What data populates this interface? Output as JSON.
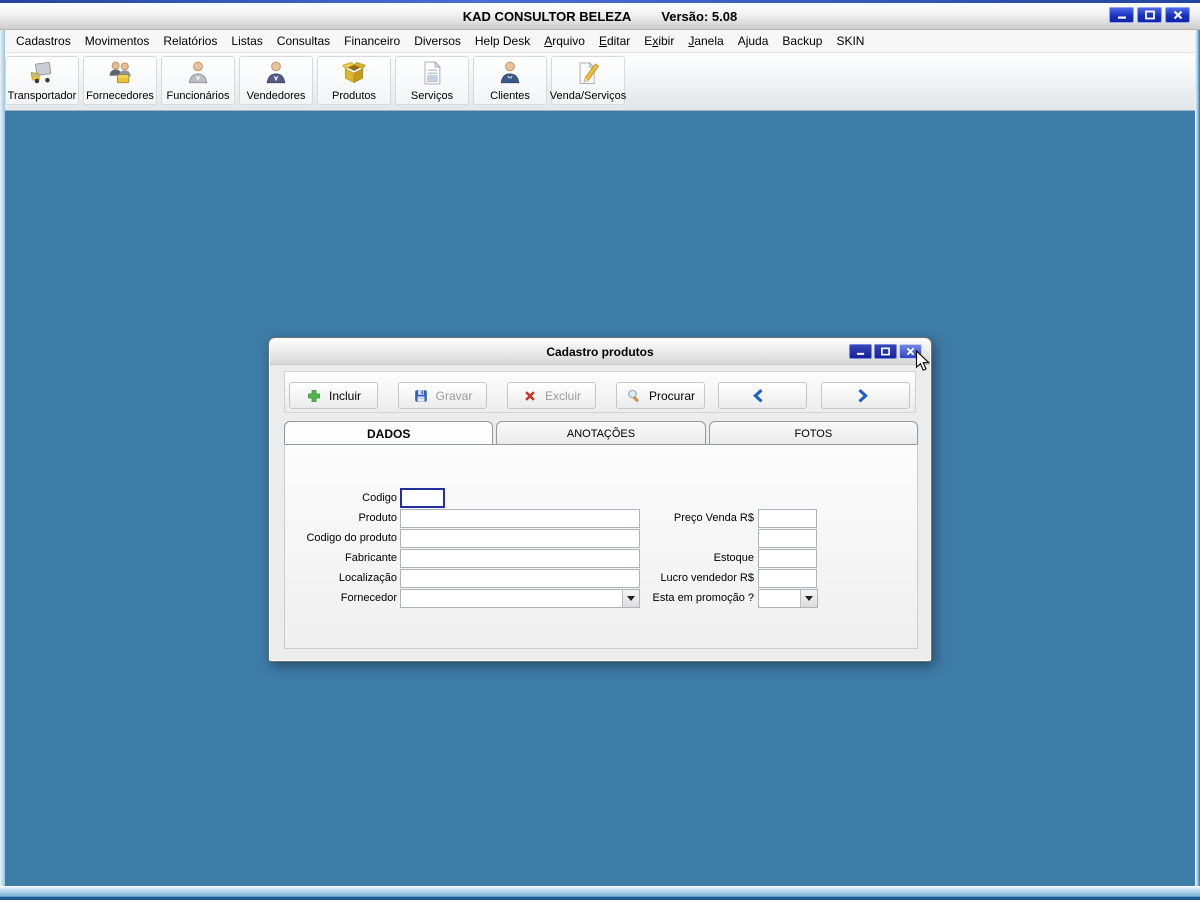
{
  "window": {
    "title": "KAD CONSULTOR BELEZA",
    "version": "Versão: 5.08"
  },
  "menubar": {
    "items": [
      {
        "label": "Cadastros"
      },
      {
        "label": "Movimentos"
      },
      {
        "label": "Relatórios"
      },
      {
        "label": "Listas"
      },
      {
        "label": "Consultas"
      },
      {
        "label": "Financeiro"
      },
      {
        "label": "Diversos"
      },
      {
        "label": "Help Desk"
      },
      {
        "label": "Arquivo",
        "accel": 0
      },
      {
        "label": "Editar",
        "accel": 0
      },
      {
        "label": "Exibir",
        "accel": 1
      },
      {
        "label": "Janela",
        "accel": 0
      },
      {
        "label": "Ajuda"
      },
      {
        "label": "Backup"
      },
      {
        "label": "SKIN"
      }
    ]
  },
  "toolbar": {
    "buttons": [
      {
        "label": "Transportador",
        "icon": "truck-icon"
      },
      {
        "label": "Fornecedores",
        "icon": "suppliers-icon"
      },
      {
        "label": "Funcionários",
        "icon": "employee-icon"
      },
      {
        "label": "Vendedores",
        "icon": "salesperson-icon"
      },
      {
        "label": "Produtos",
        "icon": "box-icon"
      },
      {
        "label": "Serviços",
        "icon": "document-icon"
      },
      {
        "label": "Clientes",
        "icon": "client-icon"
      },
      {
        "label": "Venda/Serviços",
        "icon": "sale-note-icon"
      }
    ]
  },
  "dialog": {
    "title": "Cadastro produtos",
    "toolbar": {
      "buttons": [
        {
          "label": "Incluir",
          "icon": "add-icon",
          "enabled": true
        },
        {
          "label": "Gravar",
          "icon": "save-icon",
          "enabled": false
        },
        {
          "label": "Excluir",
          "icon": "delete-icon",
          "enabled": false
        },
        {
          "label": "Procurar",
          "icon": "search-icon",
          "enabled": true
        },
        {
          "label": "",
          "icon": "chevron-left-icon",
          "enabled": true
        },
        {
          "label": "",
          "icon": "chevron-right-icon",
          "enabled": true
        }
      ]
    },
    "tabs": [
      {
        "label": "DADOS",
        "active": true
      },
      {
        "label": "ANOTAÇÕES",
        "active": false
      },
      {
        "label": "FOTOS",
        "active": false
      }
    ],
    "form": {
      "codigo": {
        "label": "Codigo",
        "value": ""
      },
      "produto": {
        "label": "Produto",
        "value": ""
      },
      "codigo_do_produto": {
        "label": "Codigo do produto",
        "value": ""
      },
      "fabricante": {
        "label": "Fabricante",
        "value": ""
      },
      "localizacao": {
        "label": "Localização",
        "value": ""
      },
      "fornecedor": {
        "label": "Fornecedor",
        "value": ""
      },
      "preco_venda": {
        "label": "Preço Venda R$",
        "value": ""
      },
      "campo_sem_rotulo": {
        "label": "",
        "value": ""
      },
      "estoque": {
        "label": "Estoque",
        "value": ""
      },
      "lucro_vendedor": {
        "label": "Lucro vendedor R$",
        "value": ""
      },
      "esta_em_promocao": {
        "label": "Esta em promoção ?",
        "value": ""
      }
    }
  },
  "colors": {
    "desktop": "#3e7ca8",
    "window_button_blue": "#1730c0",
    "dialog_button_navy": "#16219a",
    "disabled_text": "#9b9b9b",
    "focused_input_border": "#232f9e"
  }
}
